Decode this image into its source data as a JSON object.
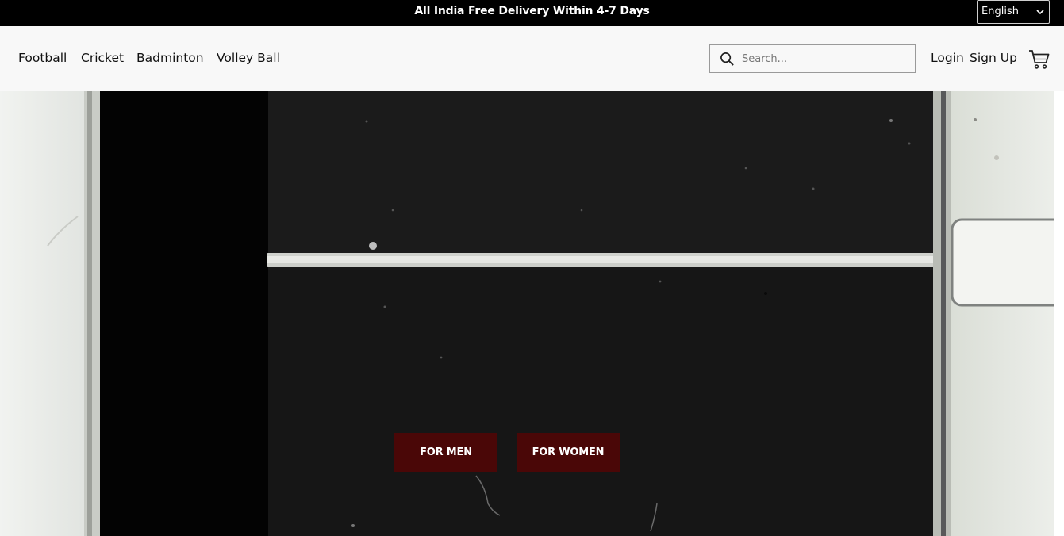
{
  "announcement": {
    "text": "All India Free Delivery Within 4-7 Days"
  },
  "language_select": {
    "selected": "English"
  },
  "nav": {
    "items": [
      {
        "label": "Football"
      },
      {
        "label": "Cricket"
      },
      {
        "label": "Badminton"
      },
      {
        "label": "Volley Ball"
      }
    ],
    "search_placeholder": "Search...",
    "login_label": "Login",
    "signup_label": "Sign Up",
    "icons": {
      "search": "search-icon",
      "cart": "cart-icon",
      "dropdown": "chevron-down-icon"
    }
  },
  "hero": {
    "buttons": [
      {
        "label": "FOR MEN"
      },
      {
        "label": "FOR WOMEN"
      }
    ],
    "colors": {
      "cta": "#4a0707",
      "topbar": "#000000",
      "navbar": "#f8f8f8"
    }
  }
}
